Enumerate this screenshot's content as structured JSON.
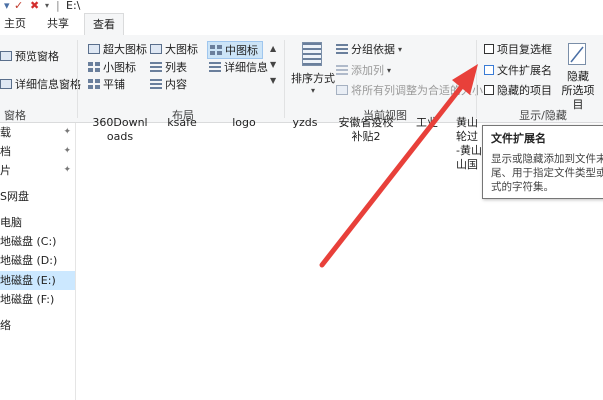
{
  "window": {
    "title": "E:\\",
    "up_arrow": "|",
    "close_glyph": "✖",
    "dropdown_glyph": "▾"
  },
  "tabs": [
    {
      "label": "主页"
    },
    {
      "label": "共享"
    },
    {
      "label": "查看"
    }
  ],
  "ribbon": {
    "panes_group": {
      "preview_pane": "预览窗格",
      "details_pane": "详细信息窗格",
      "label": "窗格"
    },
    "layout_group": {
      "extra_large_icons": "超大图标",
      "large_icons": "大图标",
      "medium_icons": "中图标",
      "small_icons": "小图标",
      "list": "列表",
      "details": "详细信息",
      "tiles": "平铺",
      "content": "内容",
      "label": "布局"
    },
    "current_view_group": {
      "sort_by": "排序方式",
      "group_by": "分组依据",
      "add_columns": "添加列",
      "size_all_columns": "将所有列调整为合适的大小",
      "label": "当前视图"
    },
    "show_hide_group": {
      "item_check_boxes": "项目复选框",
      "file_name_extensions": "文件扩展名",
      "hidden_items": "隐藏的项目",
      "hide_selected_line1": "隐藏",
      "hide_selected_line2": "所选项目",
      "label": "显示/隐藏"
    }
  },
  "nav_pane": {
    "items": [
      {
        "label": "载"
      },
      {
        "label": "档"
      },
      {
        "label": "片"
      },
      {
        "label": "S网盘"
      },
      {
        "label": "电脑"
      },
      {
        "label": "地磁盘 (C:)"
      },
      {
        "label": "地磁盘 (D:)"
      },
      {
        "label": "地磁盘 (E:)"
      },
      {
        "label": "地磁盘 (F:)"
      },
      {
        "label": "络"
      }
    ],
    "pin_glyph": "📌"
  },
  "files": [
    {
      "line1": "360Downl",
      "line2": "oads"
    },
    {
      "line1": "ksafe",
      "line2": ""
    },
    {
      "line1": "logo",
      "line2": ""
    },
    {
      "line1": "yzds",
      "line2": ""
    },
    {
      "line1": "安徽省疫校",
      "line2": "补贴2"
    },
    {
      "line1": "工业",
      "line2": ""
    },
    {
      "line1": "黄山",
      "line2": "轮过",
      "line3": "-黄山",
      "line4": "山国"
    }
  ],
  "tooltip": {
    "title": "文件扩展名",
    "body": "显示或隐藏添加到文件末尾、用于指定文件类型或格式的字符集。"
  },
  "colors": {
    "annotation_arrow": "#e8403a",
    "selected_nav": "#cce8ff",
    "ribbon_bg": "#f5f6f7"
  }
}
